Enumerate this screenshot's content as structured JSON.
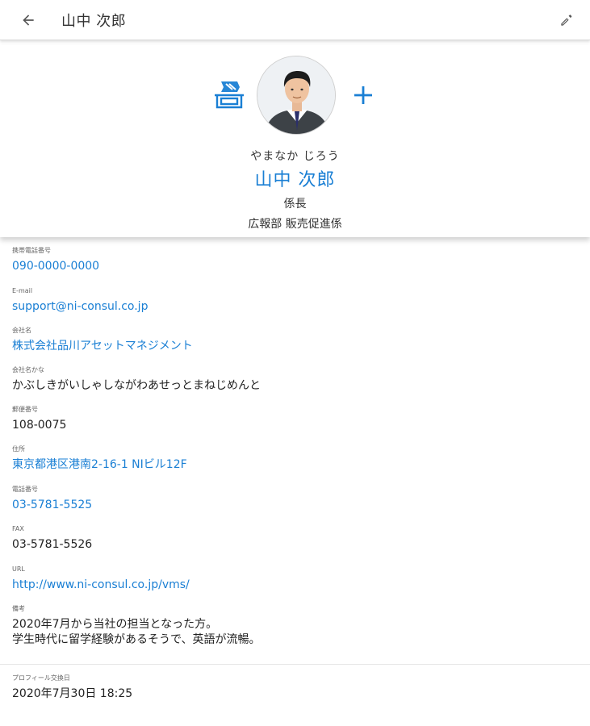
{
  "appbar": {
    "title": "山中 次郎"
  },
  "profile": {
    "kana": "やまなか じろう",
    "name": "山中 次郎",
    "position": "係長",
    "department": "広報部 販売促進係"
  },
  "fields": [
    {
      "label": "携帯電話番号",
      "value": "090-0000-0000",
      "link": true
    },
    {
      "label": "E-mail",
      "value": "support@ni-consul.co.jp",
      "link": true
    },
    {
      "label": "会社名",
      "value": "株式会社品川アセットマネジメント",
      "link": true
    },
    {
      "label": "会社名かな",
      "value": "かぶしきがいしゃしながわあせっとまねじめんと",
      "link": false
    },
    {
      "label": "郵便番号",
      "value": "108-0075",
      "link": false
    },
    {
      "label": "住所",
      "value": "東京都港区港南2-16-1 NIビル12F",
      "link": true
    },
    {
      "label": "電話番号",
      "value": "03-5781-5525",
      "link": true
    },
    {
      "label": "FAX",
      "value": "03-5781-5526",
      "link": false
    },
    {
      "label": "URL",
      "value": "http://www.ni-consul.co.jp/vms/",
      "link": true
    },
    {
      "label": "備考",
      "value": "2020年7月から当社の担当となった方。\n学生時代に留学経験があるそうで、英語が流暢。",
      "link": false
    }
  ],
  "exchange": {
    "label": "プロフィール交換日",
    "value": "2020年7月30日 18:25"
  },
  "colors": {
    "accent": "#1a7fd4"
  }
}
